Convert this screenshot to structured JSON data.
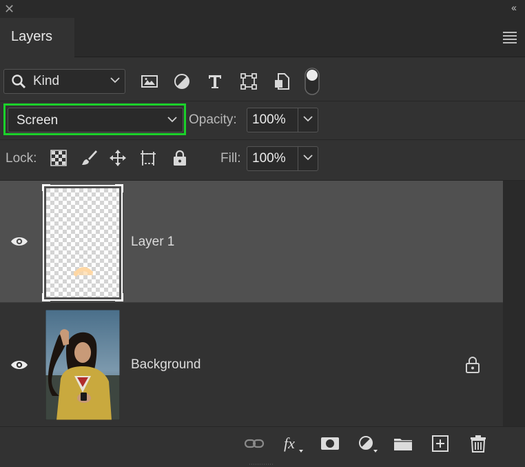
{
  "panel": {
    "tab_label": "Layers",
    "close_icon": "close-icon",
    "collapse_icon": "collapse-chevrons-icon",
    "menu_icon": "panel-menu-icon"
  },
  "filter": {
    "kind_label": "Kind",
    "icons": [
      "image-filter-icon",
      "adjustment-filter-icon",
      "type-filter-icon",
      "shape-filter-icon",
      "smart-object-filter-icon",
      "filter-toggle-icon"
    ]
  },
  "blend": {
    "mode": "Screen",
    "opacity_label": "Opacity:",
    "opacity_value": "100%",
    "highlight_color": "#1bd12a"
  },
  "lock": {
    "label": "Lock:",
    "icons": [
      "lock-transparent-pixels-icon",
      "lock-image-pixels-icon",
      "lock-position-icon",
      "lock-artboard-icon",
      "lock-all-icon"
    ],
    "fill_label": "Fill:",
    "fill_value": "100%"
  },
  "layers": [
    {
      "name": "Layer 1",
      "visible": true,
      "selected": true,
      "locked": false
    },
    {
      "name": "Background",
      "visible": true,
      "selected": false,
      "locked": true
    }
  ],
  "bottom_icons": [
    "link-layers-icon",
    "fx-icon",
    "add-mask-icon",
    "adjustment-layer-icon",
    "group-folder-icon",
    "new-layer-icon",
    "delete-icon"
  ]
}
